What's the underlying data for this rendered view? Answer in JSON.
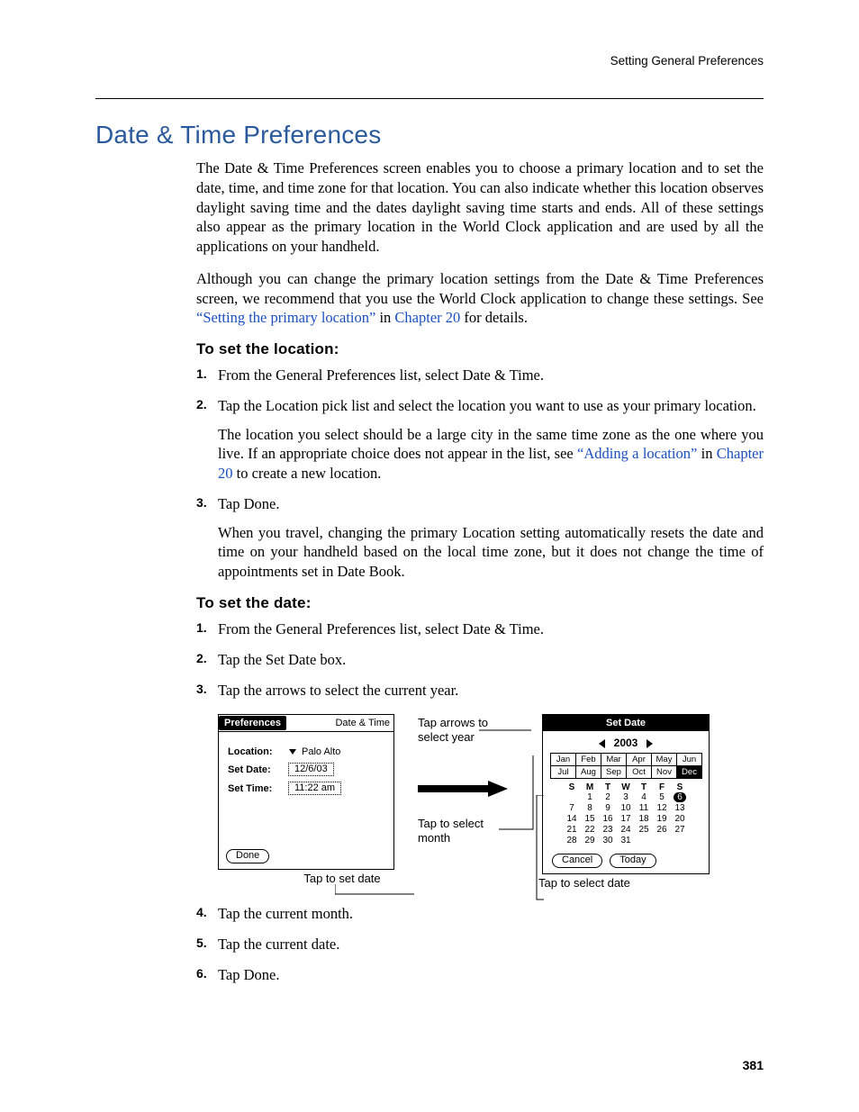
{
  "running_head": "Setting General Preferences",
  "page_number": "381",
  "section_title": "Date & Time Preferences",
  "para1": "The Date & Time Preferences screen enables you to choose a primary location and to set the date, time, and time zone for that location. You can also indicate whether this location observes daylight saving time and the dates daylight saving time starts and ends. All of these settings also appear as the primary location in the World Clock application and are used by all the applications on your handheld.",
  "para2_pre": "Although you can change the primary location settings from the Date & Time Preferences screen, we recommend that you use the World Clock application to change these settings. See ",
  "para2_link1": "“Setting the primary location”",
  "para2_mid": " in ",
  "para2_link2": "Chapter 20",
  "para2_post": " for details.",
  "sub1": "To set the location:",
  "loc_step1": "From the General Preferences list, select Date & Time.",
  "loc_step2": "Tap the Location pick list and select the location you want to use as your primary location.",
  "loc_step2_cont_pre": "The location you select should be a large city in the same time zone as the one where you live. If an appropriate choice does not appear in the list, see ",
  "loc_step2_link1": "“Adding a location”",
  "loc_step2_cont_mid": " in ",
  "loc_step2_link2": "Chapter 20",
  "loc_step2_cont_post": " to create a new location.",
  "loc_step3": "Tap Done.",
  "loc_step3_cont": "When you travel, changing the primary Location setting automatically resets the date and time on your handheld based on the local time zone, but it does not change the time of appointments set in Date Book.",
  "sub2": "To set the date:",
  "date_step1": "From the General Preferences list, select Date & Time.",
  "date_step2": "Tap the Set Date box.",
  "date_step3": "Tap the arrows to select the current year.",
  "date_step4": "Tap the current month.",
  "date_step5": "Tap the current date.",
  "date_step6": "Tap Done.",
  "prefs_panel": {
    "title_left": "Preferences",
    "title_right": "Date & Time",
    "location_label": "Location:",
    "location_value": "Palo Alto",
    "setdate_label": "Set Date:",
    "setdate_value": "12/6/03",
    "settime_label": "Set Time:",
    "settime_value": "11:22 am",
    "done": "Done",
    "caption": "Tap to set date"
  },
  "annotations": {
    "top": "Tap arrows to select year",
    "mid": "Tap to select month"
  },
  "setdate_panel": {
    "title": "Set Date",
    "year": "2003",
    "months_row1": [
      "Jan",
      "Feb",
      "Mar",
      "Apr",
      "May",
      "Jun"
    ],
    "months_row2": [
      "Jul",
      "Aug",
      "Sep",
      "Oct",
      "Nov",
      "Dec"
    ],
    "selected_month": "Dec",
    "weekdays": [
      "S",
      "M",
      "T",
      "W",
      "T",
      "F",
      "S"
    ],
    "weeks": [
      [
        "",
        "1",
        "2",
        "3",
        "4",
        "5",
        "6"
      ],
      [
        "7",
        "8",
        "9",
        "10",
        "11",
        "12",
        "13"
      ],
      [
        "14",
        "15",
        "16",
        "17",
        "18",
        "19",
        "20"
      ],
      [
        "21",
        "22",
        "23",
        "24",
        "25",
        "26",
        "27"
      ],
      [
        "28",
        "29",
        "30",
        "31",
        "",
        "",
        ""
      ]
    ],
    "today_cell": "6",
    "cancel": "Cancel",
    "today_btn": "Today",
    "caption": "Tap to select date"
  }
}
